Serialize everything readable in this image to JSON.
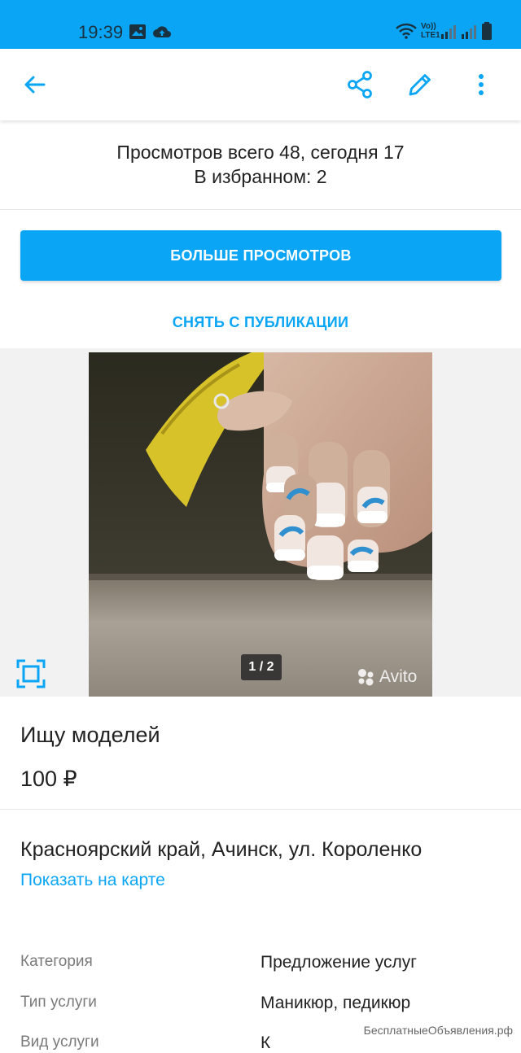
{
  "status_bar": {
    "time": "19:39",
    "network_label_top": "Vo))",
    "network_label_bottom": "LTE1",
    "colors": {
      "background": "#0aa6f5"
    }
  },
  "app_bar": {
    "icons": [
      "arrow-left-icon",
      "share-icon",
      "pencil-icon",
      "more-vertical-icon"
    ]
  },
  "stats": {
    "views_line": "Просмотров всего 48, сегодня 17",
    "favorites_line": "В избранном: 2"
  },
  "actions": {
    "more_views": "БОЛЬШЕ ПРОСМОТРОВ",
    "unpublish": "СНЯТЬ С ПУБЛИКАЦИИ"
  },
  "gallery": {
    "counter": "1 / 2",
    "watermark": "Avito"
  },
  "listing": {
    "title": "Ищу моделей",
    "price": "100 ₽",
    "address": "Красноярский край, Ачинск, ул. Короленко",
    "map_link": "Показать на карте"
  },
  "params": [
    {
      "label": "Категория",
      "value": "Предложение услуг"
    },
    {
      "label": "Тип услуги",
      "value": "Маникюр, педикюр"
    },
    {
      "label": "Вид услуги",
      "value": "К"
    }
  ],
  "site_watermark": "БесплатныеОбъявления.рф",
  "colors": {
    "accent": "#0aa6f5",
    "text": "#222222",
    "muted": "#7a7a7a"
  }
}
